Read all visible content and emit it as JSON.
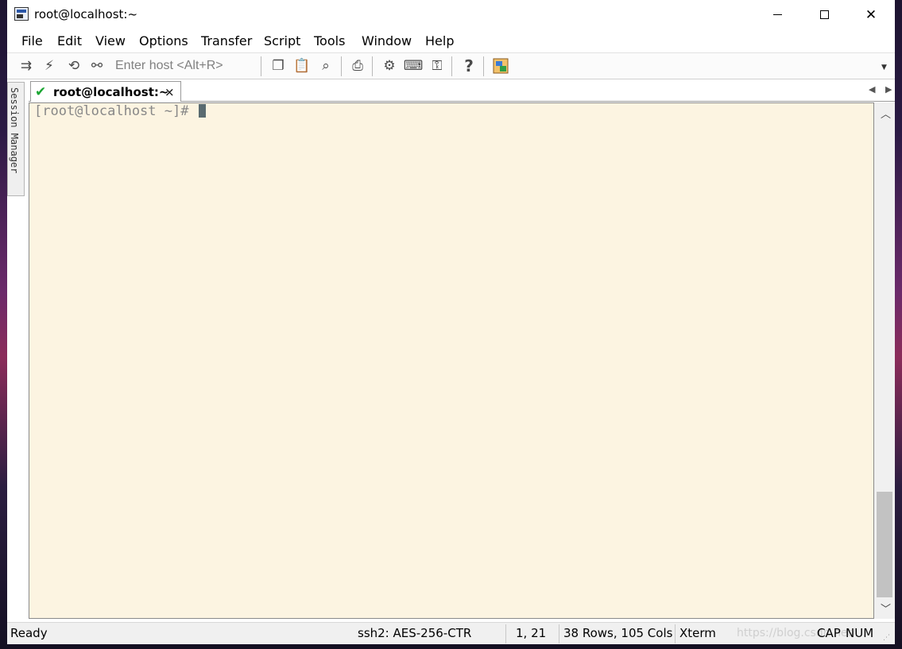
{
  "window": {
    "title": "root@localhost:~"
  },
  "menu": {
    "items": [
      {
        "label": "File"
      },
      {
        "label": "Edit"
      },
      {
        "label": "View"
      },
      {
        "label": "Options"
      },
      {
        "label": "Transfer"
      },
      {
        "label": "Script"
      },
      {
        "label": "Tools"
      },
      {
        "label": "Window"
      },
      {
        "label": "Help"
      }
    ]
  },
  "toolbar": {
    "host_placeholder": "Enter host <Alt+R>",
    "icons": [
      "connect-icon",
      "quick-connect-icon",
      "reconnect-icon",
      "disconnect-icon",
      "copy-icon",
      "paste-icon",
      "find-icon",
      "print-icon",
      "session-options-icon",
      "keymap-icon",
      "key-icon",
      "help-icon",
      "securefx-icon"
    ]
  },
  "session_manager": {
    "label": "Session Manager"
  },
  "tab": {
    "label": "root@localhost:~",
    "close": "×"
  },
  "terminal": {
    "prompt": "[root@localhost ~]# "
  },
  "status": {
    "ready": "Ready",
    "cipher": "ssh2: AES-256-CTR",
    "position": "1,  21",
    "size": "38 Rows, 105 Cols",
    "term_type": "Xterm",
    "cap": "CAP",
    "num": "NUM",
    "watermark": "https://blog.csdn.net/..."
  }
}
